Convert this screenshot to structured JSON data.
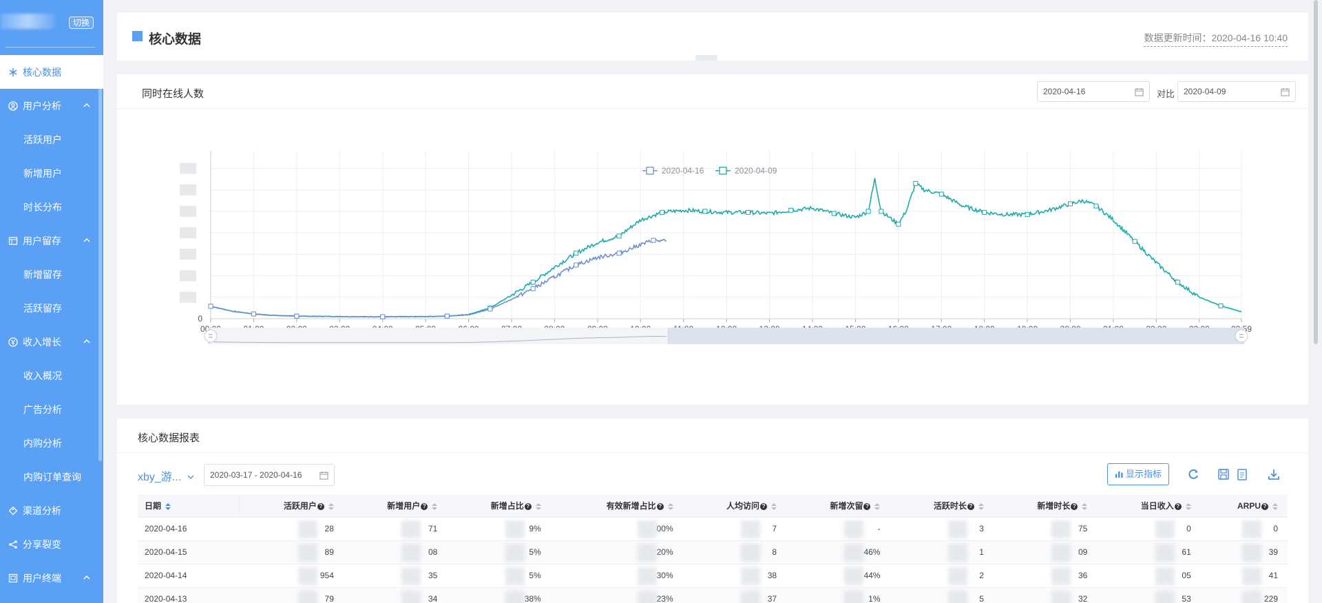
{
  "sidebar": {
    "switch_label": "切换",
    "items": [
      {
        "label": "核心数据",
        "icon": "snowflake-icon",
        "type": "parent",
        "active": true
      },
      {
        "label": "用户分析",
        "icon": "user-circle-icon",
        "type": "parent",
        "expanded": true
      },
      {
        "label": "活跃用户",
        "type": "child"
      },
      {
        "label": "新增用户",
        "type": "child"
      },
      {
        "label": "时长分布",
        "type": "child"
      },
      {
        "label": "用户留存",
        "icon": "table-icon",
        "type": "parent",
        "expanded": true
      },
      {
        "label": "新增留存",
        "type": "child"
      },
      {
        "label": "活跃留存",
        "type": "child"
      },
      {
        "label": "收入增长",
        "icon": "yen-icon",
        "type": "parent",
        "expanded": true
      },
      {
        "label": "收入概况",
        "type": "child"
      },
      {
        "label": "广告分析",
        "type": "child"
      },
      {
        "label": "内购分析",
        "type": "child"
      },
      {
        "label": "内购订单查询",
        "type": "child"
      },
      {
        "label": "渠道分析",
        "icon": "tag-icon",
        "type": "parent"
      },
      {
        "label": "分享裂变",
        "icon": "share-icon",
        "type": "parent"
      },
      {
        "label": "用户终端",
        "icon": "device-icon",
        "type": "parent",
        "expanded": true
      }
    ]
  },
  "header": {
    "title": "核心数据",
    "update_time": "数据更新时间：2020-04-16 10:40"
  },
  "online_card": {
    "title": "同时在线人数",
    "date_a": "2020-04-16",
    "vs_label": "对比",
    "date_b": "2020-04-09"
  },
  "chart_data": {
    "type": "line",
    "title": "",
    "legend_position": "top-center",
    "grid": true,
    "xlabel": "",
    "ylabel": "",
    "x_ticks": [
      "00:00",
      "01:00",
      "02:00",
      "03:00",
      "04:00",
      "05:00",
      "06:00",
      "07:00",
      "08:00",
      "09:00",
      "10:00",
      "11:00",
      "12:00",
      "13:00",
      "14:00",
      "15:00",
      "16:00",
      "17:00",
      "18:00",
      "19:00",
      "20:00",
      "21:00",
      "22:00",
      "23:00",
      "23:59"
    ],
    "y_ticks_visible": [
      "0"
    ],
    "y_level_count": 8,
    "series": [
      {
        "name": "2020-04-16",
        "color": "#6e8fcf",
        "x_hours": [
          0,
          0.5,
          1,
          1.5,
          2,
          3,
          4,
          5,
          5.5,
          6,
          6.5,
          7,
          7.5,
          8,
          8.5,
          9,
          9.5,
          10,
          10.3,
          10.6
        ],
        "y_level": [
          0.58,
          0.35,
          0.22,
          0.15,
          0.12,
          0.1,
          0.09,
          0.1,
          0.12,
          0.18,
          0.45,
          0.9,
          1.4,
          1.95,
          2.5,
          2.85,
          3.05,
          3.45,
          3.65,
          3.6
        ]
      },
      {
        "name": "2020-04-09",
        "color": "#1aaba8",
        "x_hours": [
          0,
          0.5,
          1,
          1.5,
          2,
          3,
          4,
          5,
          5.5,
          6,
          6.5,
          7,
          7.5,
          8,
          8.5,
          9,
          9.5,
          10,
          10.5,
          11,
          11.5,
          12,
          12.5,
          13,
          13.5,
          14,
          14.5,
          15,
          15.3,
          15.45,
          15.6,
          15.8,
          16,
          16.2,
          16.4,
          16.6,
          17,
          17.5,
          18,
          18.5,
          19,
          19.5,
          20,
          20.3,
          20.6,
          21,
          21.5,
          22,
          22.5,
          23,
          23.5,
          23.98
        ],
        "y_level": [
          0.58,
          0.35,
          0.22,
          0.15,
          0.12,
          0.1,
          0.09,
          0.1,
          0.12,
          0.2,
          0.5,
          1.1,
          1.7,
          2.4,
          3.05,
          3.55,
          3.85,
          4.6,
          4.95,
          5.05,
          5.0,
          4.95,
          4.95,
          4.9,
          5.05,
          5.15,
          4.9,
          4.72,
          5.0,
          6.5,
          5.0,
          4.7,
          4.4,
          5.1,
          6.3,
          6.0,
          5.8,
          5.25,
          4.95,
          4.85,
          4.85,
          5.05,
          5.35,
          5.5,
          5.25,
          4.6,
          3.6,
          2.6,
          1.7,
          1.0,
          0.6,
          0.32
        ]
      }
    ],
    "blurred_y_labels": true
  },
  "report_card": {
    "title": "核心数据报表",
    "game_select": "xby_游...",
    "date_range": "2020-03-17 - 2020-04-16",
    "show_metrics_label": "显示指标",
    "tools": [
      "refresh-icon",
      "save-icon",
      "copy-icon",
      "download-icon"
    ],
    "columns": [
      {
        "label": "日期",
        "help": false
      },
      {
        "label": "活跃用户",
        "help": true
      },
      {
        "label": "新增用户",
        "help": true
      },
      {
        "label": "新增占比",
        "help": true
      },
      {
        "label": "有效新增占比",
        "help": true
      },
      {
        "label": "人均访问",
        "help": true
      },
      {
        "label": "新增次留",
        "help": true
      },
      {
        "label": "活跃时长",
        "help": true
      },
      {
        "label": "新增时长",
        "help": true
      },
      {
        "label": "当日收入",
        "help": true
      },
      {
        "label": "ARPU",
        "help": true
      }
    ],
    "rows": [
      [
        "2020-04-16",
        "28",
        "71",
        "9%",
        "00%",
        "7",
        "-",
        "3",
        "75",
        "0",
        "0"
      ],
      [
        "2020-04-15",
        "89",
        "08",
        "5%",
        "20%",
        "8",
        "46%",
        "1",
        "09",
        "61",
        "39"
      ],
      [
        "2020-04-14",
        "954",
        "35",
        "5%",
        "30%",
        "38",
        "44%",
        "2",
        "36",
        "05",
        "41"
      ],
      [
        "2020-04-13",
        "79",
        "34",
        "38%",
        "23%",
        "37",
        "1%",
        "5",
        "32",
        "53",
        "229"
      ]
    ]
  }
}
